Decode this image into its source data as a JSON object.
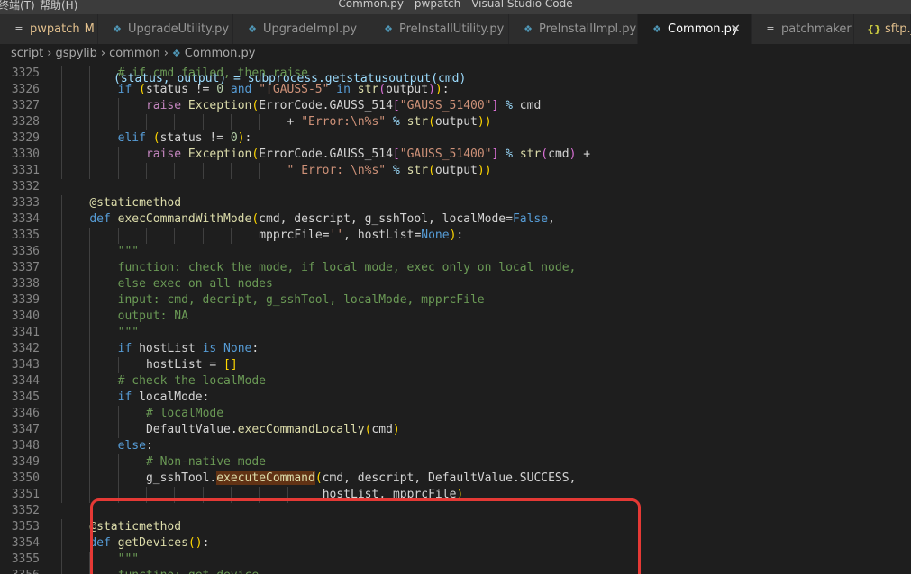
{
  "window": {
    "title": "Common.py - pwpatch - Visual Studio Code",
    "menu_left": "终端(T)",
    "menu_help": "帮助(H)"
  },
  "tabs": [
    {
      "label": "pwpatch",
      "badge": "M",
      "icon": "folder-icon"
    },
    {
      "label": "UpgradeUtility.py",
      "icon": "python-icon"
    },
    {
      "label": "UpgradeImpl.py",
      "icon": "python-icon"
    },
    {
      "label": "PreInstallUtility.py",
      "icon": "python-icon"
    },
    {
      "label": "PreInstallImpl.py",
      "icon": "python-icon"
    },
    {
      "label": "Common.py",
      "icon": "python-icon",
      "active": true
    },
    {
      "label": "patchmaker",
      "icon": "file-icon"
    },
    {
      "label": "sftp.js",
      "icon": "json-braces-icon"
    }
  ],
  "breadcrumb": [
    "script",
    "gspylib",
    "common",
    "Common.py"
  ],
  "code": {
    "first_line_fragment": "(status, output) = subprocess.getstatusoutput(cmd)",
    "lines": [
      {
        "n": "3325",
        "text": "# if cmd failed, then raise"
      },
      {
        "n": "3326",
        "text": "if (status != 0 and \"[GAUSS-5\" in str(output)):"
      },
      {
        "n": "3327",
        "text": "raise Exception(ErrorCode.GAUSS_514[\"GAUSS_51400\"] % cmd"
      },
      {
        "n": "3328",
        "text": "+ \"Error:\\n%s\" % str(output))"
      },
      {
        "n": "3329",
        "text": "elif (status != 0):"
      },
      {
        "n": "3330",
        "text": "raise Exception(ErrorCode.GAUSS_514[\"GAUSS_51400\"] % str(cmd) +"
      },
      {
        "n": "3331",
        "text": "\" Error: \\n%s\" % str(output))"
      },
      {
        "n": "3332",
        "text": ""
      },
      {
        "n": "3333",
        "text": "@staticmethod"
      },
      {
        "n": "3334",
        "text": "def execCommandWithMode(cmd, descript, g_sshTool, localMode=False,"
      },
      {
        "n": "3335",
        "text": "mpprcFile='', hostList=None):"
      },
      {
        "n": "3336",
        "text": "\"\"\""
      },
      {
        "n": "3337",
        "text": "function: check the mode, if local mode, exec only on local node,"
      },
      {
        "n": "3338",
        "text": "else exec on all nodes"
      },
      {
        "n": "3339",
        "text": "input: cmd, decript, g_sshTool, localMode, mpprcFile"
      },
      {
        "n": "3340",
        "text": "output: NA"
      },
      {
        "n": "3341",
        "text": "\"\"\""
      },
      {
        "n": "3342",
        "text": "if hostList is None:"
      },
      {
        "n": "3343",
        "text": "hostList = []"
      },
      {
        "n": "3344",
        "text": "# check the localMode"
      },
      {
        "n": "3345",
        "text": "if localMode:"
      },
      {
        "n": "3346",
        "text": "# localMode"
      },
      {
        "n": "3347",
        "text": "DefaultValue.execCommandLocally(cmd)"
      },
      {
        "n": "3348",
        "text": "else:"
      },
      {
        "n": "3349",
        "text": "# Non-native mode"
      },
      {
        "n": "3350",
        "text": "g_sshTool.executeCommand(cmd, descript, DefaultValue.SUCCESS,"
      },
      {
        "n": "3351",
        "text": "hostList, mpprcFile)"
      },
      {
        "n": "3352",
        "text": ""
      },
      {
        "n": "3353",
        "text": "@staticmethod"
      },
      {
        "n": "3354",
        "text": "def getDevices():"
      },
      {
        "n": "3355",
        "text": "\"\"\""
      },
      {
        "n": "3356",
        "text": "functino: get device"
      }
    ]
  },
  "annotation": {
    "color": "#e53935"
  }
}
